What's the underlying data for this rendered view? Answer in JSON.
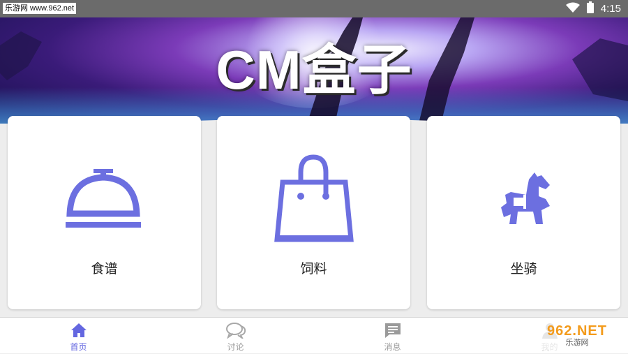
{
  "status_bar": {
    "watermark": "乐游网 www.962.net",
    "time": "4:15",
    "icons": [
      "wifi-icon",
      "battery-icon"
    ]
  },
  "banner": {
    "title": "CM盒子"
  },
  "cards": [
    {
      "label": "食谱",
      "icon": "serving-cloche-icon"
    },
    {
      "label": "饲料",
      "icon": "shopping-bag-icon"
    },
    {
      "label": "坐骑",
      "icon": "horse-icon"
    }
  ],
  "tabbar": {
    "items": [
      {
        "label": "首页",
        "icon": "home-icon",
        "active": true
      },
      {
        "label": "讨论",
        "icon": "chat-bubbles-icon",
        "active": false
      },
      {
        "label": "消息",
        "icon": "message-icon",
        "active": false
      },
      {
        "label": "我的",
        "icon": "user-icon",
        "active": false
      }
    ]
  },
  "watermark_bottom": {
    "logo": "962.NET",
    "subtitle": "乐游网"
  },
  "colors": {
    "accent": "#6467e0",
    "icon_purple": "#6c6fe0",
    "status_bar": "#6b6b6b",
    "background": "#ededed"
  }
}
